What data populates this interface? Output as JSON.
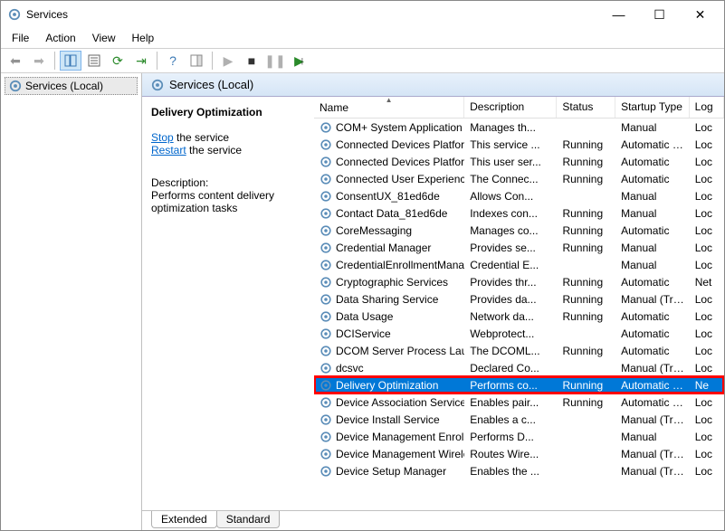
{
  "window": {
    "title": "Services",
    "minimize": "—",
    "maximize": "☐",
    "close": "✕"
  },
  "menu": [
    "File",
    "Action",
    "View",
    "Help"
  ],
  "tree": {
    "root": "Services (Local)"
  },
  "header": {
    "title": "Services (Local)"
  },
  "detail": {
    "service_name": "Delivery Optimization",
    "stop_text": "Stop",
    "restart_text": "Restart",
    "the_service": " the service",
    "desc_label": "Description:",
    "description": "Performs content delivery optimization tasks"
  },
  "columns": {
    "name": "Name",
    "description": "Description",
    "status": "Status",
    "startup": "Startup Type",
    "logon": "Log"
  },
  "services": [
    {
      "name": "COM+ System Application",
      "desc": "Manages th...",
      "status": "",
      "startup": "Manual",
      "log": "Loc"
    },
    {
      "name": "Connected Devices Platfor...",
      "desc": "This service ...",
      "status": "Running",
      "startup": "Automatic (...",
      "log": "Loc"
    },
    {
      "name": "Connected Devices Platfor...",
      "desc": "This user ser...",
      "status": "Running",
      "startup": "Automatic",
      "log": "Loc"
    },
    {
      "name": "Connected User Experience...",
      "desc": "The Connec...",
      "status": "Running",
      "startup": "Automatic",
      "log": "Loc"
    },
    {
      "name": "ConsentUX_81ed6de",
      "desc": "Allows Con...",
      "status": "",
      "startup": "Manual",
      "log": "Loc"
    },
    {
      "name": "Contact Data_81ed6de",
      "desc": "Indexes con...",
      "status": "Running",
      "startup": "Manual",
      "log": "Loc"
    },
    {
      "name": "CoreMessaging",
      "desc": "Manages co...",
      "status": "Running",
      "startup": "Automatic",
      "log": "Loc"
    },
    {
      "name": "Credential Manager",
      "desc": "Provides se...",
      "status": "Running",
      "startup": "Manual",
      "log": "Loc"
    },
    {
      "name": "CredentialEnrollmentMana...",
      "desc": "Credential E...",
      "status": "",
      "startup": "Manual",
      "log": "Loc"
    },
    {
      "name": "Cryptographic Services",
      "desc": "Provides thr...",
      "status": "Running",
      "startup": "Automatic",
      "log": "Net"
    },
    {
      "name": "Data Sharing Service",
      "desc": "Provides da...",
      "status": "Running",
      "startup": "Manual (Trig...",
      "log": "Loc"
    },
    {
      "name": "Data Usage",
      "desc": "Network da...",
      "status": "Running",
      "startup": "Automatic",
      "log": "Loc"
    },
    {
      "name": "DCIService",
      "desc": "Webprotect...",
      "status": "",
      "startup": "Automatic",
      "log": "Loc"
    },
    {
      "name": "DCOM Server Process Laun...",
      "desc": "The DCOML...",
      "status": "Running",
      "startup": "Automatic",
      "log": "Loc"
    },
    {
      "name": "dcsvc",
      "desc": "Declared Co...",
      "status": "",
      "startup": "Manual (Trig...",
      "log": "Loc"
    },
    {
      "name": "Delivery Optimization",
      "desc": "Performs co...",
      "status": "Running",
      "startup": "Automatic (...",
      "log": "Ne",
      "selected": true,
      "highlighted": true
    },
    {
      "name": "Device Association Service",
      "desc": "Enables pair...",
      "status": "Running",
      "startup": "Automatic (T...",
      "log": "Loc"
    },
    {
      "name": "Device Install Service",
      "desc": "Enables a c...",
      "status": "",
      "startup": "Manual (Trig...",
      "log": "Loc"
    },
    {
      "name": "Device Management Enroll...",
      "desc": "Performs D...",
      "status": "",
      "startup": "Manual",
      "log": "Loc"
    },
    {
      "name": "Device Management Wirele...",
      "desc": "Routes Wire...",
      "status": "",
      "startup": "Manual (Trig...",
      "log": "Loc"
    },
    {
      "name": "Device Setup Manager",
      "desc": "Enables the ...",
      "status": "",
      "startup": "Manual (Trig...",
      "log": "Loc"
    }
  ],
  "tabs": {
    "extended": "Extended",
    "standard": "Standard"
  }
}
